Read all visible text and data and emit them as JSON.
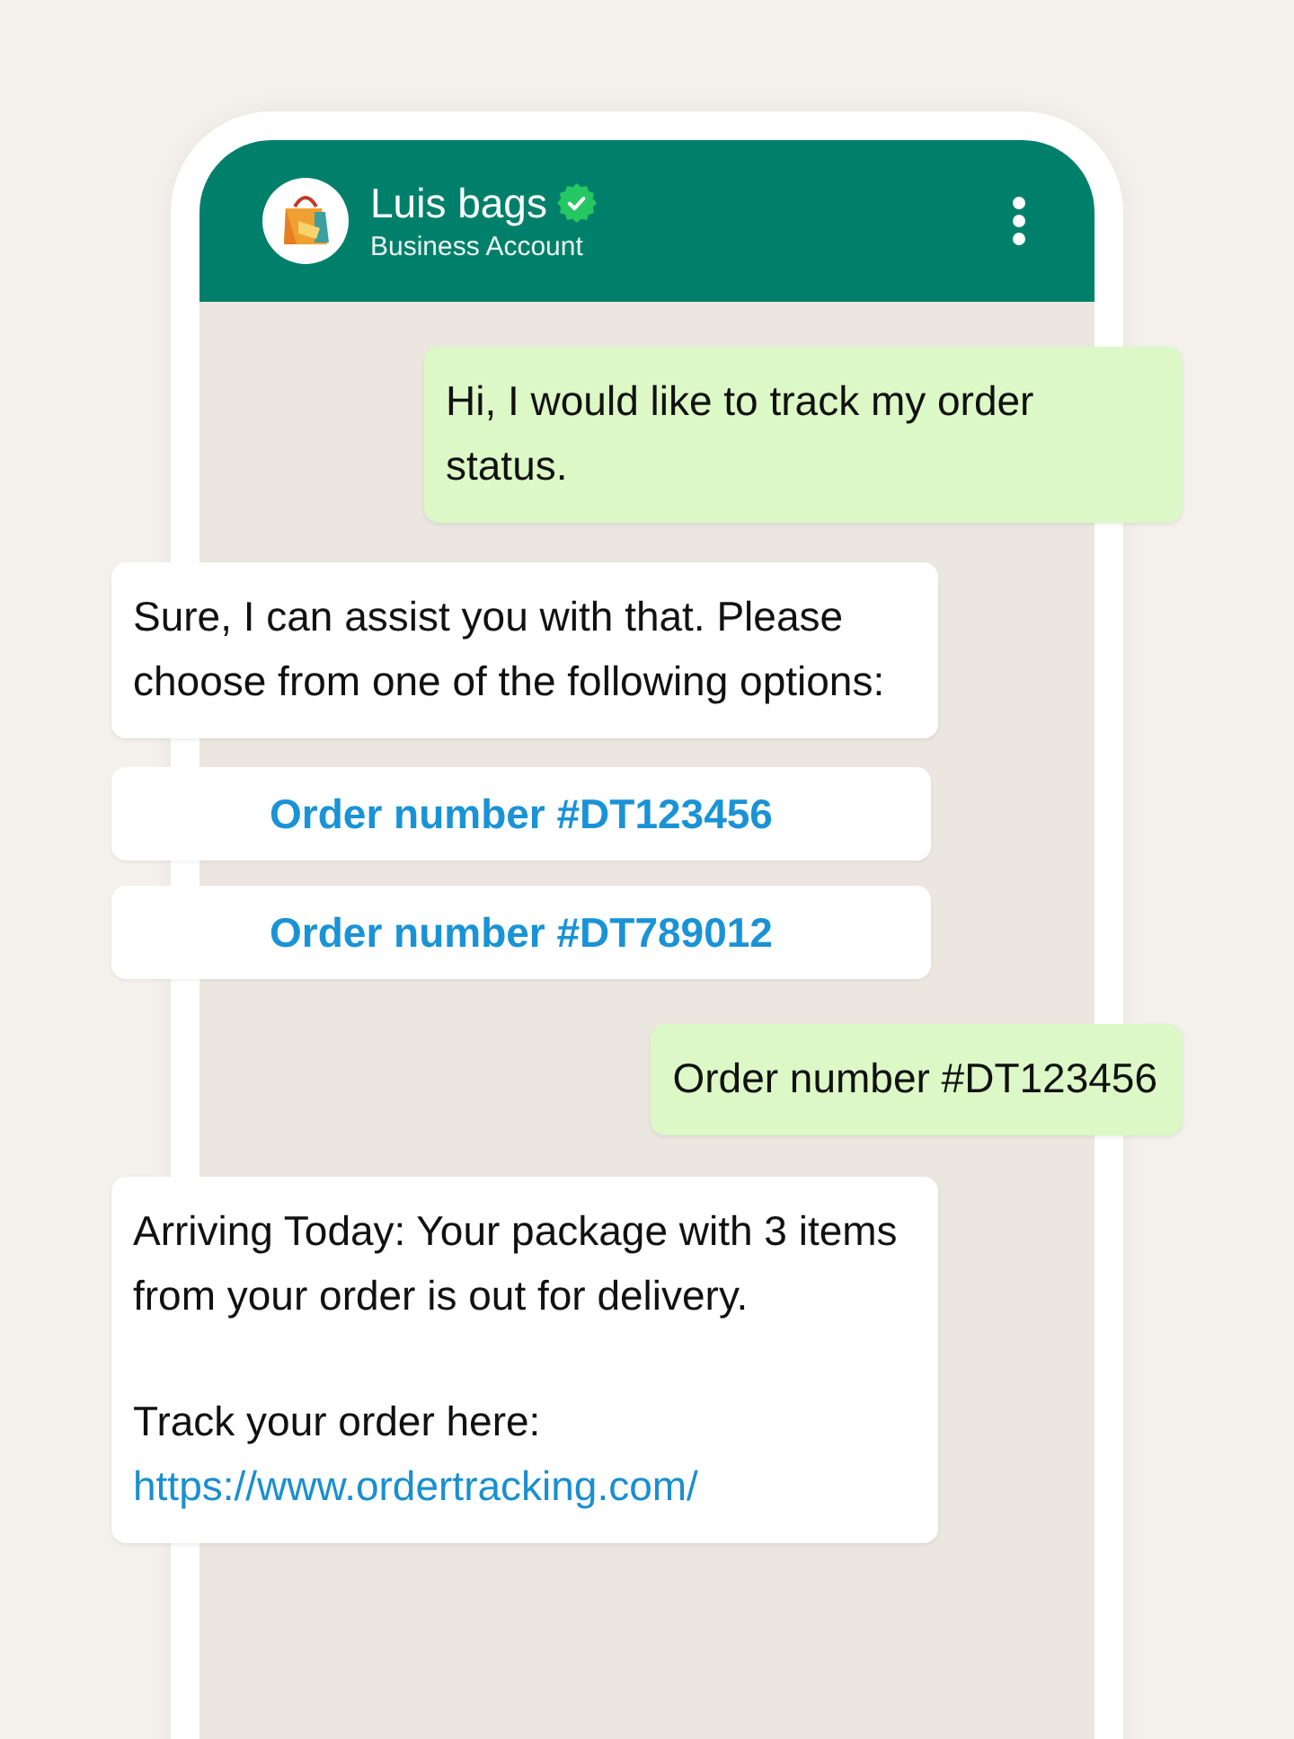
{
  "header": {
    "name": "Luis bags",
    "verified": true,
    "subtitle": "Business Account"
  },
  "messages": [
    {
      "kind": "outgoing",
      "paragraphs": [
        {
          "text": "Hi, I would like to track my order status."
        }
      ]
    },
    {
      "kind": "incoming",
      "paragraphs": [
        {
          "text": "Sure, I can assist you with that. Please choose from one of the following options:"
        }
      ]
    },
    {
      "kind": "option",
      "label": "Order number #DT123456"
    },
    {
      "kind": "option",
      "label": "Order number #DT789012"
    },
    {
      "kind": "outgoing",
      "paragraphs": [
        {
          "text": "Order number #DT123456"
        }
      ]
    },
    {
      "kind": "incoming",
      "paragraphs": [
        {
          "text": "Arriving Today: Your package with 3 items from your order is out for delivery."
        },
        {
          "text": "Track your order here:",
          "link": "https://www.ordertracking.com/"
        }
      ]
    }
  ]
}
